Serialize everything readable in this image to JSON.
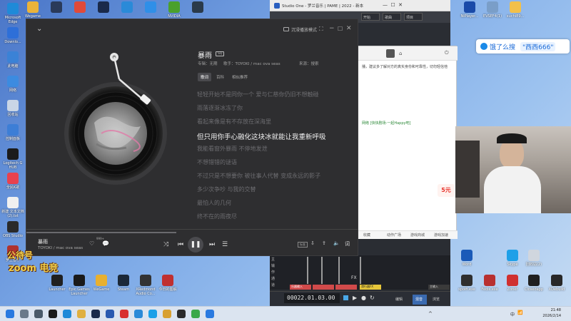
{
  "desktop_icons_left": [
    {
      "label": "Microsoft Edge",
      "color": "#1f8ad8"
    },
    {
      "label": "Downlo...",
      "color": "#2e6fd8"
    },
    {
      "label": "此电脑",
      "color": "#3b82d6"
    },
    {
      "label": "网络",
      "color": "#3c8be0"
    },
    {
      "label": "回收站",
      "color": "#c9d6e6"
    },
    {
      "label": "控制面板",
      "color": "#3d7ed6"
    },
    {
      "label": "Logitech G HUB",
      "color": "#1b1b1b"
    },
    {
      "label": "全民K歌",
      "color": "#e8424f"
    },
    {
      "label": "新建 文本文档 (2).txt",
      "color": "#f0f0f0"
    },
    {
      "label": "OBS Studio",
      "color": "#2a2a2a"
    },
    {
      "label": "罗兰音乐",
      "color": "#b0332e"
    }
  ],
  "desktop_icons_top": [
    {
      "label": "Wegame",
      "color": "#eab33a"
    },
    {
      "label": "",
      "color": "#2a3a5a"
    },
    {
      "label": "",
      "color": "#e14a3a"
    },
    {
      "label": "",
      "color": "#1a2a4a"
    },
    {
      "label": "",
      "color": "#2a8ad8"
    },
    {
      "label": "",
      "color": "#2f8fe8"
    },
    {
      "label": "NVIDIA",
      "color": "#4aa02c"
    },
    {
      "label": "",
      "color": "#2a3a4a"
    }
  ],
  "desktop_icons_right": [
    {
      "label": "NiPlayer...",
      "color": "#1a4aa8"
    },
    {
      "label": "EVSEF4(1)",
      "color": "#7a9ec8"
    },
    {
      "label": "xuchi89...",
      "color": "#f2c04a"
    },
    {
      "label": "Word",
      "color": "#1a5ab8"
    },
    {
      "label": "Skype",
      "color": "#1ea0e8"
    },
    {
      "label": "回收站(2)",
      "color": "#d0d6de"
    },
    {
      "label": "spoifi.exe",
      "color": "#2f2f2f"
    },
    {
      "label": "Fedis.exe",
      "color": "#b83030"
    },
    {
      "label": "Zoner",
      "color": "#d03030"
    },
    {
      "label": "Closedapp",
      "color": "#202020"
    },
    {
      "label": "XDebuild",
      "color": "#282828"
    }
  ],
  "desktop_icons_bottom": [
    {
      "label": "Launcher",
      "color": "#202020"
    },
    {
      "label": "Epic Games Launcher",
      "color": "#1a1a1a"
    },
    {
      "label": "WeGame",
      "color": "#e8b030"
    },
    {
      "label": "Steam",
      "color": "#1b2838"
    },
    {
      "label": "XRedmond Audio Co...",
      "color": "#333333"
    },
    {
      "label": "今日的图解",
      "color": "#c03030"
    }
  ],
  "music_player": {
    "song_title": "暴雨",
    "quality_badge": "SQ",
    "album_label": "专辑：无期",
    "singer_label": "歌手：TOYOKI / mac ova seas",
    "source_label": "来源：搜索",
    "tabs": [
      "歌词",
      "百科",
      "相似推荐"
    ],
    "immersive_mode": "沉浸播放模式",
    "lyrics": [
      "轻轻开始不是同你一个 爱与仁慈你仍旧不想触碰",
      "雨落逐渐冰冻了你",
      "看起来像是有不存放在深海里",
      "但只用你手心融化这块冰就能让我重新呼吸",
      "我能看窗外暴雨 不停地发泄",
      "不想错错的谜语",
      "不过只是不想要你 被往事人代替 变成永远的影子",
      "多少次争吵 与我的交替",
      "最怕人的几何",
      "终不在的雨夜尽"
    ],
    "active_lyric_index": 3,
    "now_playing_title": "暴雨",
    "now_playing_artist": "TOYOKI / mac ova seas",
    "play_progress_fraction": 0.45,
    "like_count": "999+",
    "quality_btn": "标准"
  },
  "daw": {
    "title": "Studio One - 罗兰音乐 | PAME | 2022 - 新本",
    "tab_start": "开始",
    "tab_song": "歌曲",
    "tab_project": "项目",
    "timecode": "00022.01.03.00",
    "timecode_sub": "小节",
    "bottom_tabs": [
      "编辑",
      "混音",
      "浏览"
    ],
    "track_labels": [
      "主输入",
      "FX"
    ],
    "button_yellow": "滑行器FX",
    "button_red": "乐器输入"
  },
  "browser": {
    "snippet_1": "播，建议多了解对方的真实身份和可靠性，切勿轻信他",
    "snippet_2": "网络 [快快剧场-一起Happy吧]",
    "footer_items": [
      "收藏",
      "动作广场",
      "游戏商城",
      "游戏加速"
    ]
  },
  "search_widget": {
    "text": "饿了么搜",
    "keyword": "\"西西666\""
  },
  "stream_overlay": {
    "line1": "公待号",
    "line2": "zoom 电竞",
    "price_tag": "5元"
  },
  "clock": {
    "time": "21:48",
    "date": "2026/2/14"
  },
  "tray_lang": "中"
}
